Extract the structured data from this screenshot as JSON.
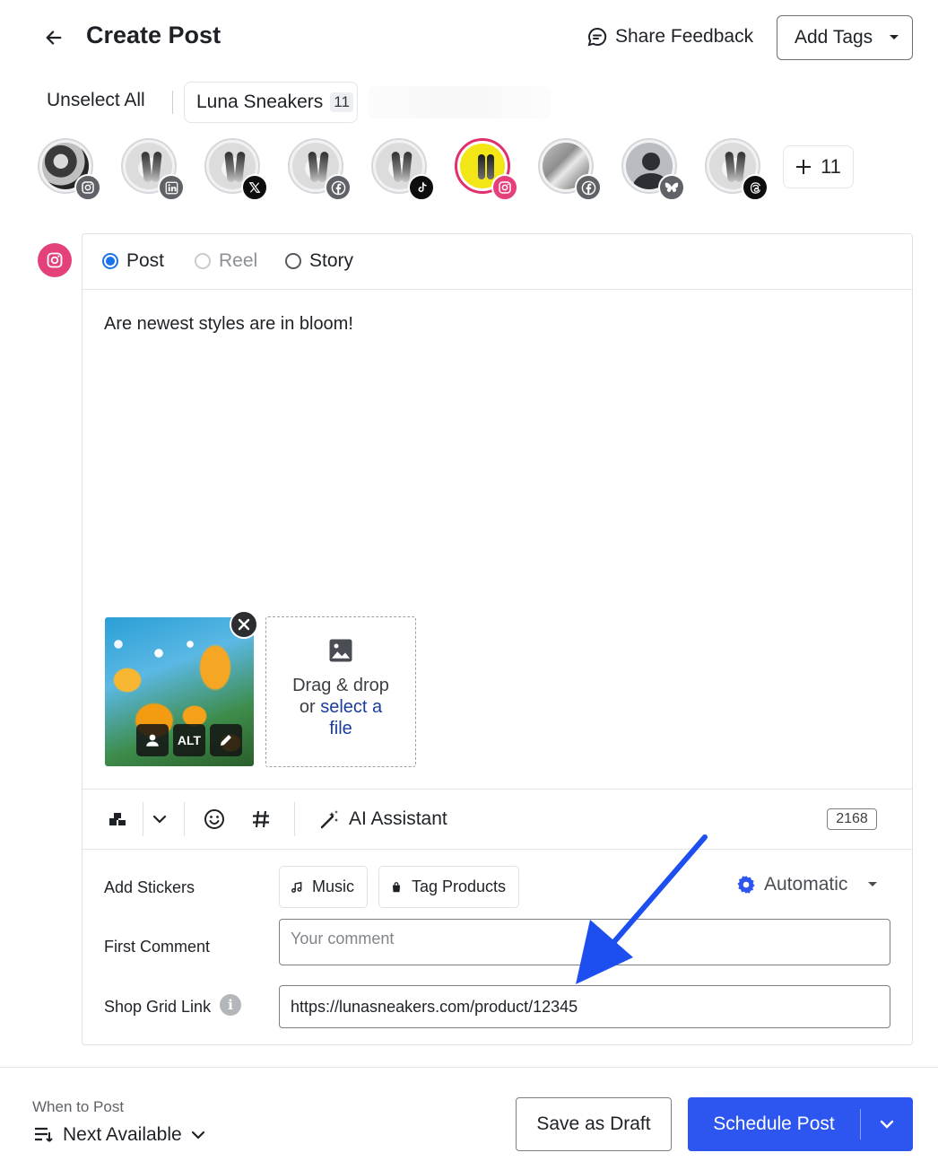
{
  "header": {
    "title": "Create Post",
    "share_feedback": "Share Feedback",
    "add_tags": "Add Tags"
  },
  "groups": {
    "unselect_all": "Unselect All",
    "group_name": "Luna Sneakers",
    "group_count": "11"
  },
  "accounts": [
    {
      "network": "instagram",
      "selected": false
    },
    {
      "network": "linkedin",
      "selected": false
    },
    {
      "network": "x",
      "selected": false
    },
    {
      "network": "facebook",
      "selected": false
    },
    {
      "network": "tiktok",
      "selected": false
    },
    {
      "network": "instagram",
      "selected": true
    },
    {
      "network": "facebook",
      "selected": false
    },
    {
      "network": "bluesky",
      "selected": false
    },
    {
      "network": "threads",
      "selected": false
    }
  ],
  "more_accounts": "11",
  "composer": {
    "post_types": {
      "post": "Post",
      "reel": "Reel",
      "story": "Story"
    },
    "selected_type": "Post",
    "text": "Are newest styles are in bloom!",
    "media": {
      "alt_label": "ALT",
      "dropzone_line1": "Drag & drop",
      "dropzone_or": "or ",
      "dropzone_link": "select a",
      "dropzone_link2": "file"
    },
    "toolbar": {
      "ai_assistant": "AI Assistant",
      "char_count": "2168"
    }
  },
  "options": {
    "add_stickers_label": "Add Stickers",
    "music": "Music",
    "tag_products": "Tag Products",
    "automatic": "Automatic",
    "first_comment_label": "First Comment",
    "first_comment_placeholder": "Your comment",
    "shop_grid_label": "Shop Grid Link",
    "shop_grid_value": "https://lunasneakers.com/product/12345"
  },
  "footer": {
    "when_label": "When to Post",
    "next_available": "Next Available",
    "save_draft": "Save as Draft",
    "schedule_post": "Schedule Post"
  },
  "colors": {
    "primary": "#2d55f0",
    "instagram": "#e4407b",
    "radio_selected": "#1a73e8",
    "annotation_arrow": "#1d4ff0"
  }
}
